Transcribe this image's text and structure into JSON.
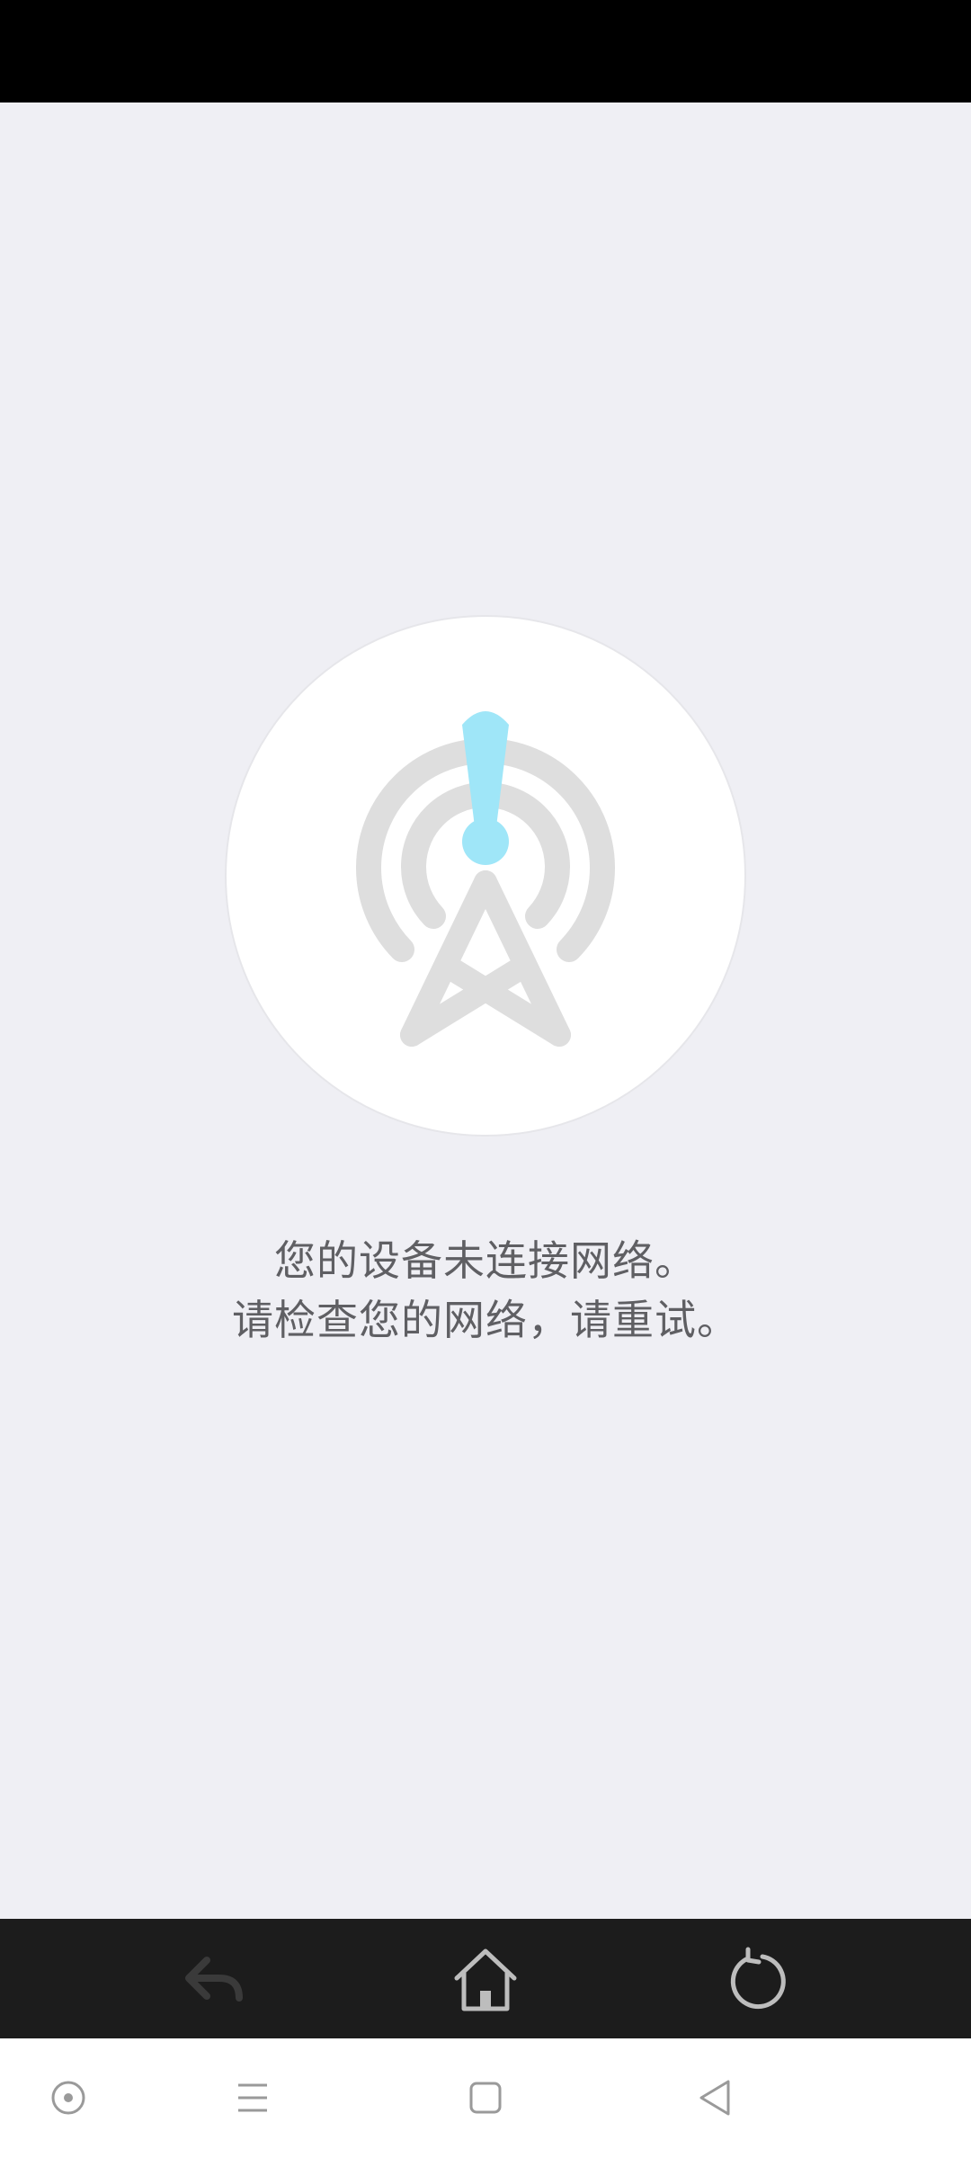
{
  "message": {
    "line1": "您的设备未连接网络。",
    "line2": "请检查您的网络，请重试。"
  },
  "colors": {
    "background": "#EFEFF4",
    "status_bar": "#000000",
    "toolbar": "#1C1C1C",
    "accent_exclamation": "#9FE6F8",
    "icon_gray": "#DEDEDE",
    "text": "#5F5F63"
  },
  "toolbar": {
    "back_icon": "back-arrow-icon",
    "home_icon": "home-icon",
    "refresh_icon": "refresh-icon"
  },
  "navbar": {
    "assist_icon": "assistive-dot-icon",
    "menu_icon": "menu-lines-icon",
    "home_icon": "square-home-icon",
    "back_icon": "triangle-back-icon"
  }
}
